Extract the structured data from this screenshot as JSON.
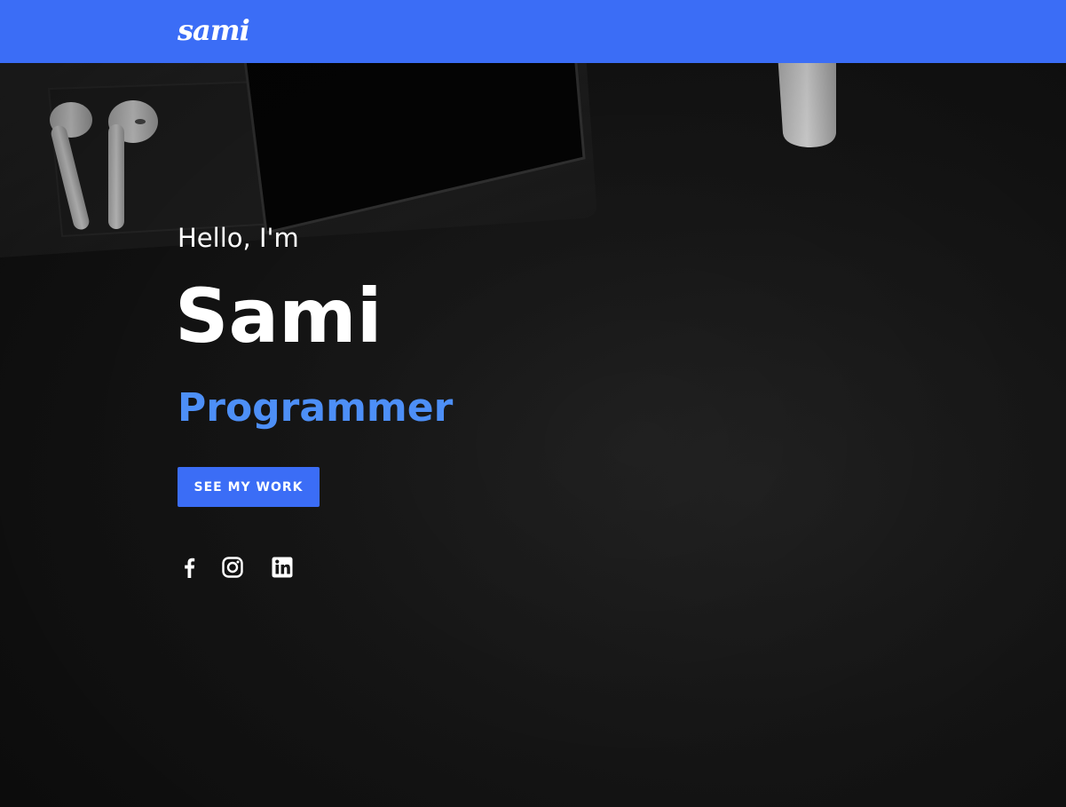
{
  "header": {
    "logo_text": "sami",
    "background_color": "#3b6df6"
  },
  "hero": {
    "greeting": "Hello, I'm",
    "name": "Sami",
    "role": "Programmer",
    "role_color": "#4d8ff7",
    "cta_label": "SEE MY WORK"
  },
  "socials": [
    {
      "icon": "facebook-icon"
    },
    {
      "icon": "instagram-icon"
    },
    {
      "icon": "linkedin-icon"
    }
  ]
}
